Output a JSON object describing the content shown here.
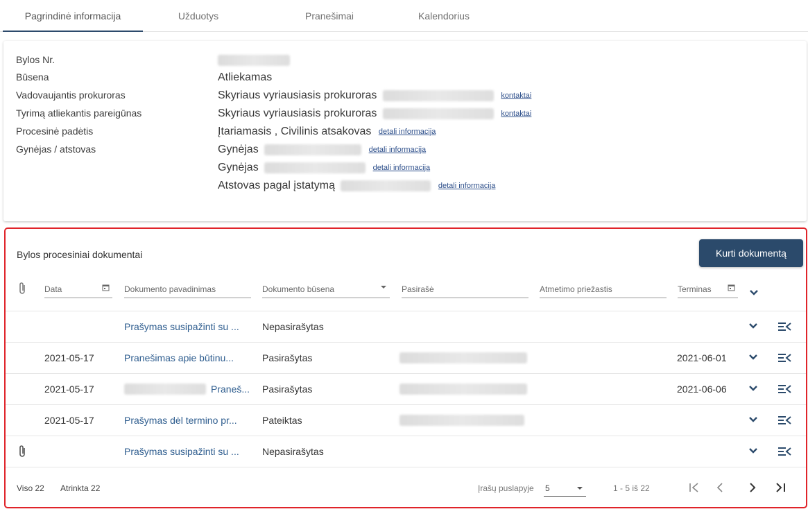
{
  "tabs": [
    {
      "label": "Pagrindinė informacija",
      "active": true
    },
    {
      "label": "Užduotys"
    },
    {
      "label": "Pranešimai"
    },
    {
      "label": "Kalendorius"
    }
  ],
  "info": {
    "labels": [
      "Bylos Nr.",
      "Būsena",
      "Vadovaujantis prokuroras",
      "Tyrimą atliekantis pareigūnas",
      "Procesinė padėtis",
      "Gynėjas / atstovas"
    ],
    "status": "Atliekamas",
    "lead_prosecutor": {
      "title": "Skyriaus vyriausiasis prokuroras",
      "link": "kontaktai"
    },
    "investigator": {
      "title": "Skyriaus vyriausiasis prokuroras",
      "link": "kontaktai"
    },
    "procedural_status": {
      "text": "Įtariamasis , Civilinis atsakovas",
      "link": "detali informacija"
    },
    "defenders": [
      {
        "role": "Gynėjas",
        "link": "detali informacija"
      },
      {
        "role": "Gynėjas",
        "link": "detali informacija"
      },
      {
        "role": "Atstovas pagal įstatymą",
        "link": "detali informacija"
      }
    ]
  },
  "docs": {
    "title": "Bylos procesiniai dokumentai",
    "create_button": "Kurti dokumentą",
    "filters": {
      "date": "Data",
      "name": "Dokumento pavadinimas",
      "status": "Dokumento būsena",
      "signer": "Pasirašė",
      "reason": "Atmetimo priežastis",
      "term": "Terminas"
    },
    "rows": [
      {
        "attachment": false,
        "date": "",
        "name": "Prašymas susipažinti su ...",
        "status": "Nepasirašytas",
        "signer_blur": false,
        "term": ""
      },
      {
        "attachment": false,
        "date": "2021-05-17",
        "name": "Pranešimas apie būtinu...",
        "status": "Pasirašytas",
        "signer_blur": true,
        "term": "2021-06-01"
      },
      {
        "attachment": false,
        "date": "2021-05-17",
        "name": "Praneš...",
        "status": "Pasirašytas",
        "signer_blur": true,
        "term": "2021-06-06",
        "name_prefix_blur": true
      },
      {
        "attachment": false,
        "date": "2021-05-17",
        "name": "Prašymas dėl termino pr...",
        "status": "Pateiktas",
        "signer_blur": true,
        "term": ""
      },
      {
        "attachment": true,
        "date": "",
        "name": "Prašymas susipažinti su ...",
        "status": "Nepasirašytas",
        "signer_blur": false,
        "term": ""
      }
    ],
    "footer": {
      "total": "Viso 22",
      "selected": "Atrinkta 22",
      "per_page_label": "Įrašų puslapyje",
      "per_page_value": "5",
      "range": "1 - 5 iš 22"
    }
  },
  "colors": {
    "accent": "#2b4a6b",
    "link": "#2d5c8e",
    "highlight_border": "#e0242a"
  }
}
